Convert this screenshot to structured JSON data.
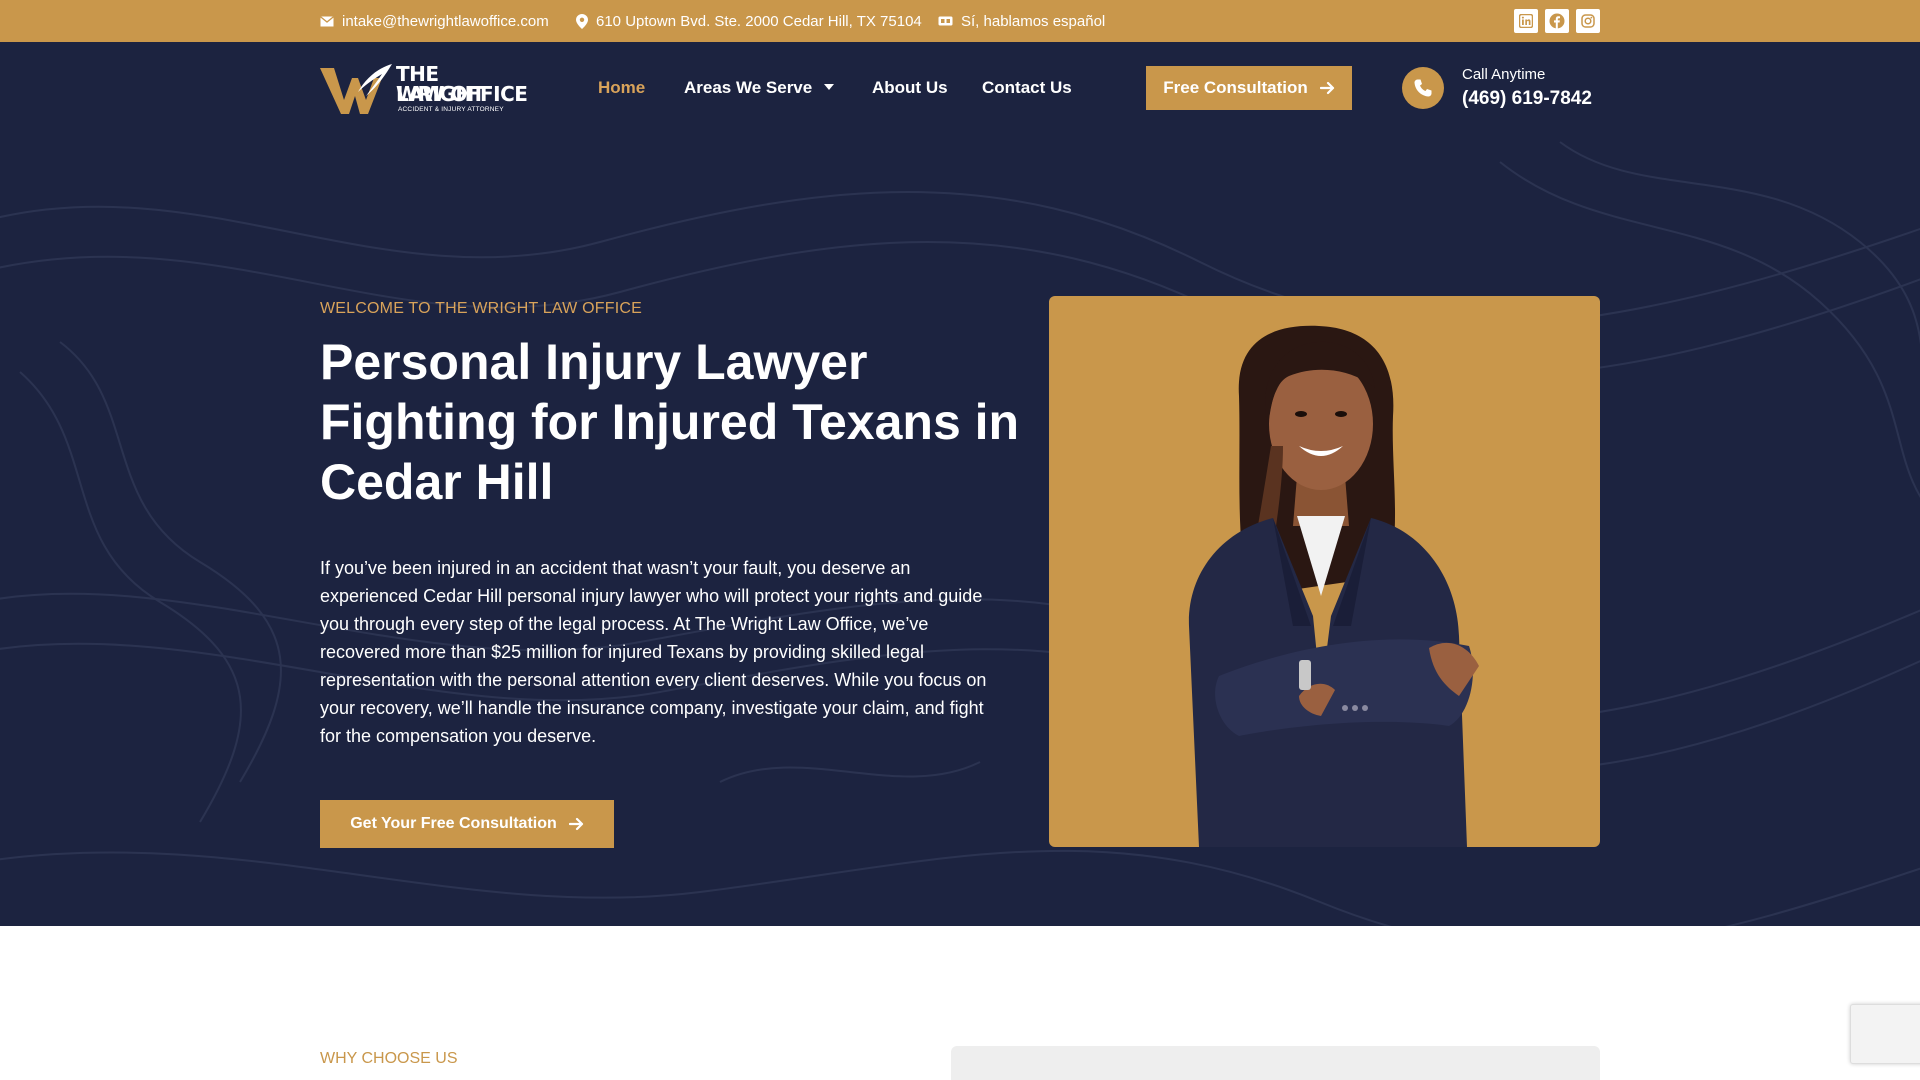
{
  "topbar": {
    "email": "intake@thewrightlawoffice.com",
    "address": "610 Uptown Bvd. Ste. 2000 Cedar Hill, TX 75104",
    "language": "Sí, hablamos español",
    "socials": [
      {
        "icon": "linkedin-icon"
      },
      {
        "icon": "facebook-icon"
      },
      {
        "icon": "instagram-icon"
      }
    ]
  },
  "logo": {
    "line1": "THE WRIGHT",
    "line2": "LAW OFFICE",
    "line3": "ACCIDENT & INJURY ATTORNEY"
  },
  "nav": {
    "items": [
      {
        "label": "Home",
        "active": true
      },
      {
        "label": "Areas We Serve",
        "dropdown": true
      },
      {
        "label": "About Us"
      },
      {
        "label": "Contact Us"
      }
    ],
    "cta_label": "Free Consultation"
  },
  "contact": {
    "call_label": "Call Anytime",
    "phone": "(469) 619-7842"
  },
  "hero": {
    "eyebrow": "WELCOME TO THE WRIGHT LAW OFFICE",
    "title": "Personal Injury Lawyer Fighting for Injured Texans in Cedar Hill",
    "body": "If you’ve been injured in an accident that wasn’t your fault, you deserve an experienced Cedar Hill personal injury lawyer who will protect your rights and guide you through every step of the legal process. At The Wright Law Office, we’ve recovered more than $25 million for injured Texans by providing skilled legal representation with the personal attention every client deserves. While you focus on your recovery, we’ll handle the insurance company, investigate your claim, and fight for the compensation you deserve.",
    "cta_label": "Get Your Free Consultation"
  },
  "section2": {
    "eyebrow": "WHY CHOOSE US"
  },
  "colors": {
    "gold": "#c9974b",
    "gold_text": "#d9a35a",
    "navy": "#1c2340"
  }
}
